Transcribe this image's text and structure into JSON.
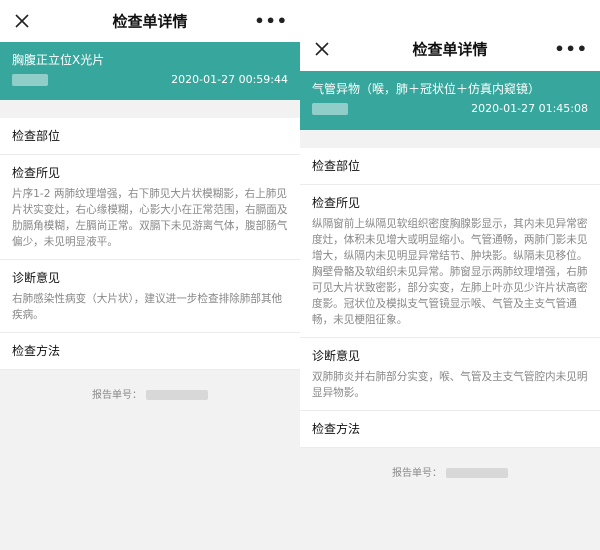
{
  "screens": [
    {
      "nav": {
        "title": "检查单详情",
        "more": "•••"
      },
      "banner": {
        "exam_name": "胸腹正立位X光片",
        "time": "2020-01-27 00:59:44"
      },
      "sections": [
        {
          "label": "检查部位",
          "content": ""
        },
        {
          "label": "检查所见",
          "content": "片序1-2 两肺纹理增强，右下肺见大片状模糊影，右上肺见片状实变灶，右心缘模糊，心影大小在正常范围，右膈面及肋膈角模糊，左膈尚正常。双膈下未见游离气体，腹部肠气偏少，未见明显液平。"
        },
        {
          "label": "诊断意见",
          "content": "右肺感染性病变（大片状），建议进一步检查排除肺部其他疾病。"
        },
        {
          "label": "检查方法",
          "content": ""
        }
      ],
      "footer": {
        "label": "报告单号："
      }
    },
    {
      "nav": {
        "title": "检查单详情",
        "more": "•••"
      },
      "banner": {
        "exam_name": "气管异物（喉，肺＋冠状位＋仿真内窥镜）",
        "time": "2020-01-27 01:45:08"
      },
      "sections": [
        {
          "label": "检查部位",
          "content": ""
        },
        {
          "label": "检查所见",
          "content": "纵隔窗前上纵隔见软组织密度胸腺影显示，其内未见异常密度灶，体积未见增大或明显缩小。气管通畅，两肺门影未见增大，纵隔内未见明显异常结节、肿块影。纵隔未见移位。胸壁骨骼及软组织未见异常。肺窗显示两肺纹理增强，右肺可见大片状致密影，部分实变，左肺上叶亦见少许片状高密度影。冠状位及模拟支气管镜显示喉、气管及主支气管通畅，未见梗阻征象。"
        },
        {
          "label": "诊断意见",
          "content": "双肺肺炎并右肺部分实变，喉、气管及主支气管腔内未见明显异物影。"
        },
        {
          "label": "检查方法",
          "content": ""
        }
      ],
      "footer": {
        "label": "报告单号："
      }
    }
  ]
}
